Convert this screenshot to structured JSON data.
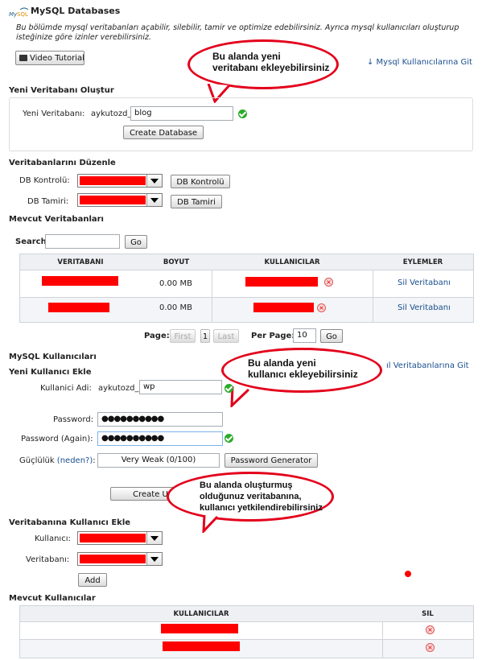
{
  "header": {
    "logo_text": "MySQL",
    "title": "MySQL Databases",
    "description": "Bu bölümde mysql veritabanları açabilir, silebilir, tamir ve optimize edebilirsiniz. Ayrıca mysql kullanıcıları oluşturup isteğinize göre izinler verebilirsiniz.",
    "video_button": "Video Tutorial",
    "users_link": "↓ Mysql Kullanıcılarına Git"
  },
  "callouts": {
    "db": [
      "Bu alanda yeni",
      "veritabanı ekleyebilirsiniz"
    ],
    "user": [
      "Bu alanda yeni",
      "kullanıcı ekleyebilirsiniz"
    ],
    "assign": [
      "Bu alanda oluşturmuş",
      "olduğunuz veritabanına,",
      "kullanıcı yetkilendirebilirsiniz"
    ]
  },
  "new_db": {
    "heading": "Yeni Veritabanı Oluştur",
    "label": "Yeni Veritabanı:",
    "prefix": "aykutozd_",
    "value": "blog",
    "button": "Create Database"
  },
  "modify": {
    "heading": "Veritabanlarını Düzenle",
    "check_label": "DB Kontrolü:",
    "check_button": "DB Kontrolü",
    "repair_label": "DB Tamiri:",
    "repair_button": "DB Tamiri"
  },
  "current_dbs": {
    "heading": "Mevcut Veritabanları",
    "search_label": "Search",
    "search_value": "",
    "go_button": "Go",
    "columns": [
      "VERITABANI",
      "BOYUT",
      "KULLANICILAR",
      "EYLEMLER"
    ],
    "rows": [
      {
        "size": "0.00 MB",
        "user_partial": "..._...",
        "action": "Sil Veritabanı"
      },
      {
        "size": "0.00 MB",
        "user_partial": "",
        "action": "Sil Veritabanı"
      }
    ],
    "page_label": "Page:",
    "first": "First",
    "page_num": "1",
    "last": "Last",
    "per_page_label": "Per Page:",
    "per_page_value": "10",
    "per_page_go": "Go"
  },
  "users": {
    "heading": "MySQL Kullanıcıları",
    "subheading": "Yeni Kullanıcı Ekle",
    "db_link": "ıl Veritabanlarına Git",
    "username_label": "Kullanici Adi:",
    "prefix": "aykutozd_",
    "username_value": "wp",
    "password_label": "Password:",
    "password_value": "●●●●●●●●●●",
    "password2_label": "Password (Again):",
    "password2_value": "●●●●●●●●●●",
    "strength_label": "Güçlülük",
    "strength_link": "(neden?)",
    "strength_suffix": ":",
    "strength_value": "Very Weak (0/100)",
    "generator_button": "Password Generator",
    "create_button": "Create U"
  },
  "assign": {
    "heading": "Veritabanına Kullanıcı Ekle",
    "user_label": "Kullanıcı:",
    "db_label": "Veritabanı:",
    "add_button": "Add"
  },
  "current_users": {
    "heading": "Mevcut Kullanıcılar",
    "columns": [
      "KULLANICILAR",
      "SIL"
    ]
  },
  "colors": {
    "redaction": "#ff0000",
    "callout_border": "#e3001b",
    "link": "#1a4f8f",
    "check": "#2bab2b"
  }
}
